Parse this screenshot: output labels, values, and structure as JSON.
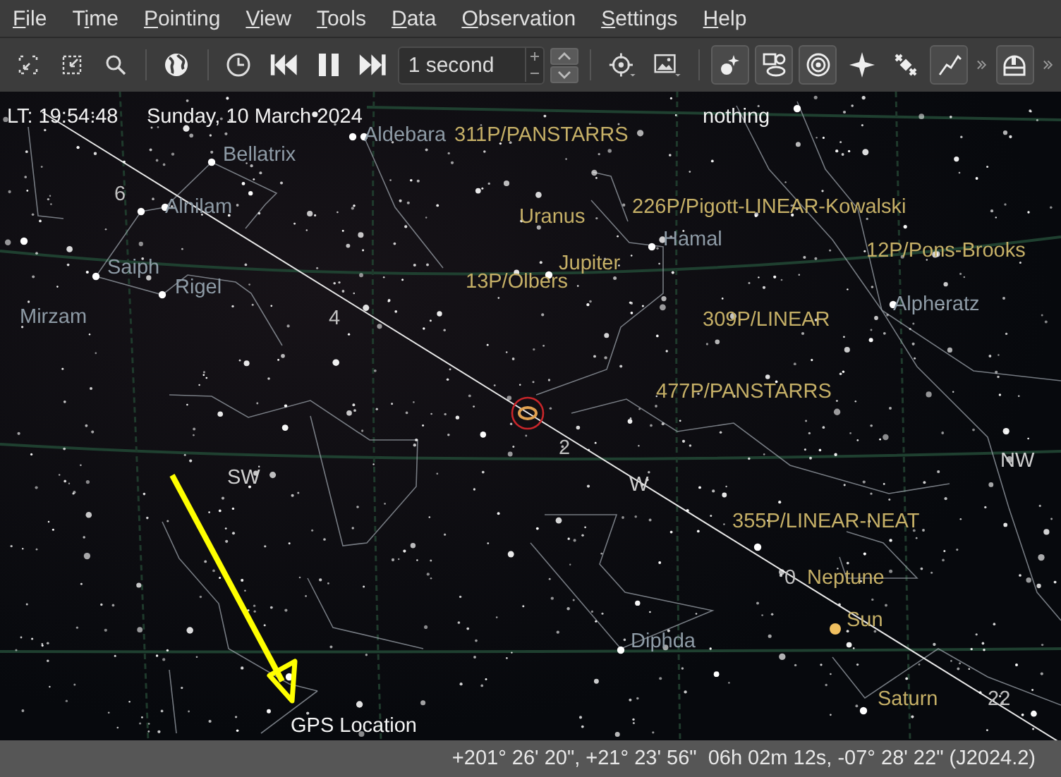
{
  "menu": [
    {
      "label": "File"
    },
    {
      "label": "Time"
    },
    {
      "label": "Pointing"
    },
    {
      "label": "View"
    },
    {
      "label": "Tools"
    },
    {
      "label": "Data"
    },
    {
      "label": "Observation"
    },
    {
      "label": "Settings"
    },
    {
      "label": "Help"
    }
  ],
  "toolbar": {
    "time_step": {
      "value": "1 second"
    },
    "view_toggles": [
      {
        "on": true
      },
      {
        "on": true
      },
      {
        "on": true
      },
      {
        "on": false
      },
      {
        "on": false
      },
      {
        "on": true
      }
    ],
    "extra_toggle": {
      "on": true
    }
  },
  "sky": {
    "time": "LT: 19:54:48",
    "date": "Sunday, 10 March 2024",
    "focus": "nothing",
    "labels": [
      {
        "text": "Aldebara",
        "kind": "star"
      },
      {
        "text": "311P/PANSTARRS",
        "kind": "solar"
      },
      {
        "text": "Bellatrix",
        "kind": "star"
      },
      {
        "text": "6",
        "kind": "grid"
      },
      {
        "text": "Alnilam",
        "kind": "star"
      },
      {
        "text": "226P/Pigott-LINEAR-Kowalski",
        "kind": "solar"
      },
      {
        "text": "Uranus",
        "kind": "solar"
      },
      {
        "text": "Hamal",
        "kind": "star"
      },
      {
        "text": "12P/Pons-Brooks",
        "kind": "solar"
      },
      {
        "text": "Jupiter",
        "kind": "solar"
      },
      {
        "text": "Saiph",
        "kind": "star"
      },
      {
        "text": "13P/Olbers",
        "kind": "solar"
      },
      {
        "text": "Rigel",
        "kind": "star"
      },
      {
        "text": "Mirzam",
        "kind": "star"
      },
      {
        "text": "4",
        "kind": "grid"
      },
      {
        "text": "Alpheratz",
        "kind": "star"
      },
      {
        "text": "309P/LINEAR",
        "kind": "solar"
      },
      {
        "text": "477P/PANSTARRS",
        "kind": "solar"
      },
      {
        "text": "2",
        "kind": "grid"
      },
      {
        "text": "NW",
        "kind": "compass"
      },
      {
        "text": "SW",
        "kind": "compass"
      },
      {
        "text": "W",
        "kind": "compass"
      },
      {
        "text": "355P/LINEAR-NEAT",
        "kind": "solar"
      },
      {
        "text": "0",
        "kind": "grid"
      },
      {
        "text": "Neptune",
        "kind": "solar"
      },
      {
        "text": "Sun",
        "kind": "solar"
      },
      {
        "text": "Diphda",
        "kind": "star"
      },
      {
        "text": "Saturn",
        "kind": "solar"
      },
      {
        "text": "22",
        "kind": "grid"
      }
    ],
    "annotation": {
      "label": "GPS Location"
    }
  },
  "status_bar": {
    "coordinates": "+201° 26' 20\", +21° 23' 56\"  06h 02m 12s, -07° 28' 22\" (J2024.2)"
  }
}
